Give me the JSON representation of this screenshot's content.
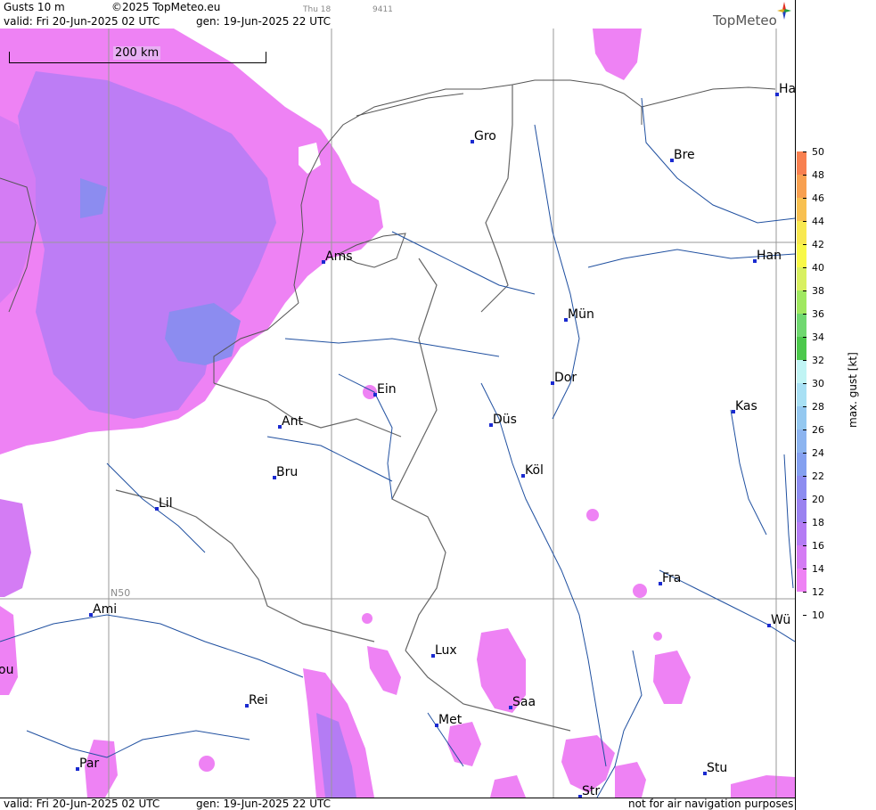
{
  "header": {
    "product": "Gusts 10 m",
    "copyright": "©2025 TopMeteo.eu",
    "day": "Thu 18",
    "code": "9411",
    "valid": "valid:  Fri  20-Jun-2025  02 UTC",
    "gen": "gen: 19-Jun-2025 22 UTC"
  },
  "logo": "TopMeteo",
  "scale_label": "200 km",
  "grid_label": "N50",
  "footer": {
    "valid": "valid:  Fri  20-Jun-2025  02 UTC",
    "gen": "gen: 19-Jun-2025 22 UTC",
    "notice": "not for air navigation purposes"
  },
  "cities": [
    {
      "name": "Gro"
    },
    {
      "name": "Bre"
    },
    {
      "name": "Ha"
    },
    {
      "name": "Ams"
    },
    {
      "name": "Han"
    },
    {
      "name": "Mün"
    },
    {
      "name": "Dor"
    },
    {
      "name": "Ein"
    },
    {
      "name": "Kas"
    },
    {
      "name": "Ant"
    },
    {
      "name": "Düs"
    },
    {
      "name": "Köl"
    },
    {
      "name": "Bru"
    },
    {
      "name": "Lil"
    },
    {
      "name": "Fra"
    },
    {
      "name": "Ami"
    },
    {
      "name": "Wü"
    },
    {
      "name": "Lux"
    },
    {
      "name": "ou"
    },
    {
      "name": "Rei"
    },
    {
      "name": "Saa"
    },
    {
      "name": "Met"
    },
    {
      "name": "Par"
    },
    {
      "name": "Stu"
    },
    {
      "name": "Str"
    }
  ],
  "legend": {
    "title": "max. gust [kt]",
    "ticks": [
      "50",
      "48",
      "46",
      "44",
      "42",
      "40",
      "38",
      "36",
      "34",
      "32",
      "30",
      "28",
      "26",
      "24",
      "22",
      "20",
      "18",
      "16",
      "14",
      "12",
      "10"
    ],
    "colors": {
      "12": "#ee82f4",
      "14": "#d47cf4",
      "16": "#b47cf4",
      "18": "#9a82f0",
      "20": "#8c8cf0",
      "22": "#84a0f0",
      "24": "#8cb4f0",
      "26": "#94c8f0",
      "28": "#a8e0f4",
      "30": "#c0f4f4",
      "32": "#4cc84c",
      "34": "#70d870",
      "36": "#a0e860",
      "38": "#d8f060",
      "40": "#f8f848",
      "42": "#f8e850",
      "44": "#f8c050",
      "46": "#f8a050",
      "48": "#f88050",
      "50": "#f46c50"
    }
  }
}
